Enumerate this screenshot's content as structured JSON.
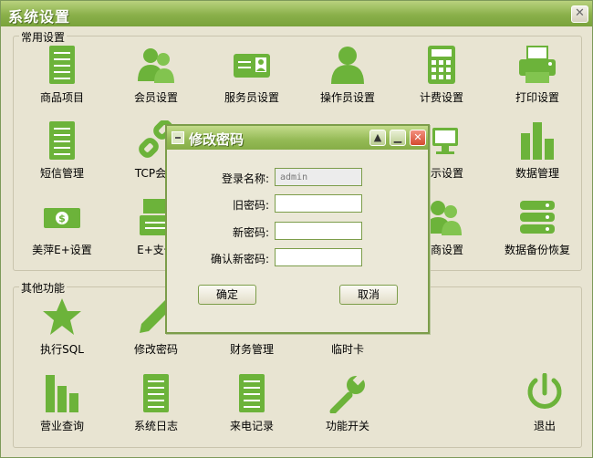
{
  "window": {
    "title": "系统设置",
    "close": "✕"
  },
  "groups": {
    "common": "常用设置",
    "other": "其他功能"
  },
  "common_items": [
    {
      "label": "商品项目",
      "icon": "product-list-icon"
    },
    {
      "label": "会员设置",
      "icon": "members-icon"
    },
    {
      "label": "服务员设置",
      "icon": "waiter-card-icon"
    },
    {
      "label": "操作员设置",
      "icon": "operator-icon"
    },
    {
      "label": "计费设置",
      "icon": "calculator-icon"
    },
    {
      "label": "打印设置",
      "icon": "printer-icon"
    },
    {
      "label": "短信管理",
      "icon": "sms-icon"
    },
    {
      "label": "TCP会员",
      "icon": "tcp-member-icon"
    },
    {
      "label": "显示设置",
      "icon": "display-icon"
    },
    {
      "label": "数据管理",
      "icon": "data-chart-icon"
    },
    {
      "label": "美萍E+设置",
      "icon": "money-icon"
    },
    {
      "label": "E+支付",
      "icon": "eplus-pay-icon"
    },
    {
      "label": "销商设置",
      "icon": "dealer-icon"
    },
    {
      "label": "数据备份恢复",
      "icon": "database-icon"
    }
  ],
  "other_items": [
    {
      "label": "执行SQL",
      "icon": "star-icon"
    },
    {
      "label": "修改密码",
      "icon": "pencil-icon"
    },
    {
      "label": "财务管理",
      "icon": "finance-icon"
    },
    {
      "label": "临时卡",
      "icon": "temp-card-icon"
    },
    {
      "label": "营业查询",
      "icon": "bar-chart-icon"
    },
    {
      "label": "系统日志",
      "icon": "log-icon"
    },
    {
      "label": "来电记录",
      "icon": "call-record-icon"
    },
    {
      "label": "功能开关",
      "icon": "wrench-icon"
    },
    {
      "label": "退出",
      "icon": "power-icon"
    }
  ],
  "dialog": {
    "title": "修改密码",
    "fields": [
      {
        "label": "登录名称:",
        "value": "admin",
        "readonly": true
      },
      {
        "label": "旧密码:",
        "value": ""
      },
      {
        "label": "新密码:",
        "value": ""
      },
      {
        "label": "确认新密码:",
        "value": ""
      }
    ],
    "ok": "确定",
    "cancel": "取消"
  },
  "colors": {
    "accent": "#7cb342",
    "title_bar": "#8ab04a",
    "background": "#e8e4d2"
  }
}
